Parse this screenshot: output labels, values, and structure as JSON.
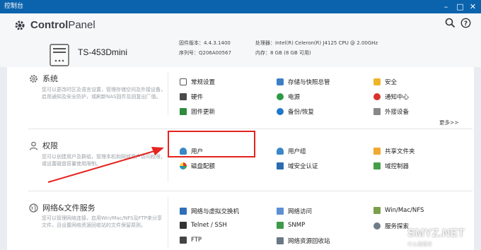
{
  "window": {
    "title": "控制台"
  },
  "header": {
    "app_name_bold": "Control",
    "app_name_rest": "Panel",
    "model": "TS-453Dmini",
    "info": [
      {
        "label": "固件版本：",
        "value": "4.4.3.1400"
      },
      {
        "label": "序列号：",
        "value": "Q206A00567"
      },
      {
        "label": "处理器：",
        "value": "Intel(R) Celeron(R) J4125 CPU @ 2.00GHz"
      },
      {
        "label": "内存：",
        "value": "8 GB (8 GB 可用)"
      }
    ]
  },
  "sections": [
    {
      "title": "系统",
      "icon": "gear-icon",
      "desc": "您可以更改时区及语言设置，管理存储空间及外接设备，启用通知及安全防护，或刷新NAS固件及回复出厂值。",
      "items": [
        "常规设置",
        "存储与快照总管",
        "安全",
        "硬件",
        "电源",
        "通知中心",
        "固件更新",
        "备份/恢复",
        "外接设备"
      ],
      "more": "更多>>"
    },
    {
      "title": "权限",
      "icon": "user-icon",
      "desc": "您可以创建用户及群组，管理本机和网域用户访问权限，或设置磁盘容量使用限制。",
      "items": [
        "用户",
        "用户组",
        "共享文件夹",
        "磁盘配额",
        "域安全认证",
        "域控制器"
      ]
    },
    {
      "title": "网络&文件服务",
      "icon": "globe-icon",
      "desc": "您可以管理网络连接，启用Win/Mac/NFS及FTP来分享文件，且设置网络资源回收站的文件保留原则。",
      "items": [
        "网络与虚拟交换机",
        "网络访问",
        "Win/Mac/NFS",
        "Telnet / SSH",
        "SNMP",
        "服务探索",
        "FTP",
        "网络资源回收站"
      ]
    }
  ],
  "watermark": {
    "text": "SMYZ.NET",
    "sub": "什么值得买"
  },
  "colors": {
    "titlebar": "#0b63ad",
    "highlight": "#e5231f",
    "arrow": "#e5231f"
  }
}
